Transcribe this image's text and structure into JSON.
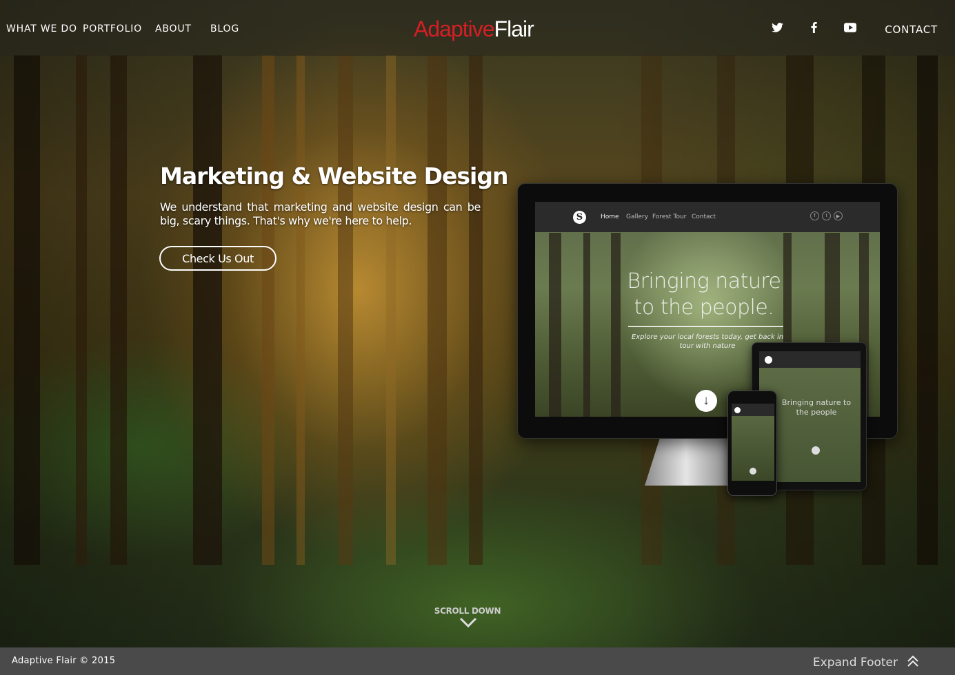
{
  "nav": {
    "what_we_do": "WHAT WE DO",
    "portfolio": "PORTFOLIO",
    "about": "ABOUT",
    "blog": "BLOG",
    "contact": "CONTACT"
  },
  "logo": {
    "part1": "Adaptive",
    "part2": "Flair",
    "part1_color": "#d41f26",
    "part2_color": "#ffffff"
  },
  "social": [
    "twitter-icon",
    "facebook-icon",
    "youtube-icon"
  ],
  "hero": {
    "title": "Marketing & Website Design",
    "subtitle": "We understand that marketing and website design can be big, scary things. That's why we're here to help.",
    "cta_label": "Check Us Out"
  },
  "mockup": {
    "nav": [
      "Home",
      "Gallery",
      "Forest Tour",
      "Contact"
    ],
    "headline_line1": "Bringing nature",
    "headline_line2": "to the people.",
    "tagline": "Explore your local forests today, get back in tour with nature",
    "tablet_headline": "Bringing nature to the people"
  },
  "scroll_down": "SCROLL DOWN",
  "footer": {
    "copyright": "Adaptive Flair © 2015",
    "expand_label": "Expand Footer"
  }
}
